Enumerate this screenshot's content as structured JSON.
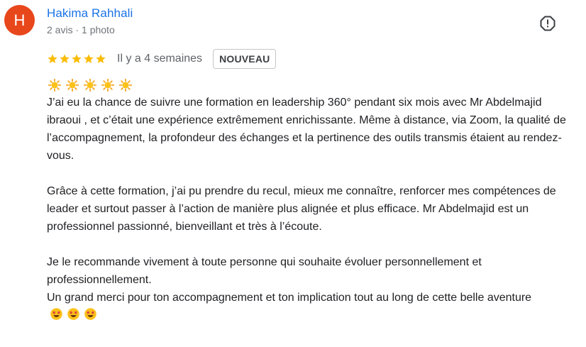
{
  "review": {
    "avatar_letter": "H",
    "avatar_color": "#e8471b",
    "author_name": "Hakima Rahhali",
    "author_meta": "2 avis · 1 photo",
    "report_icon": "report-icon",
    "rating": 5,
    "rating_max": 5,
    "star_color": "#fbbc04",
    "date": "Il y a 4 semaines",
    "badge": "NOUVEAU",
    "decor_icons": [
      "sun-emoji",
      "sun-emoji",
      "sun-emoji",
      "sun-emoji",
      "sun-emoji"
    ],
    "paragraphs": [
      "J’ai eu la chance de suivre une formation en leadership 360° pendant six mois avec Mr Abdelmajid ibraoui , et c’était une expérience extrêmement enrichissante. Même à distance, via Zoom, la qualité de l’accompagnement, la profondeur des échanges et la pertinence des outils transmis étaient au rendez-vous.",
      "Grâce à cette formation, j’ai pu prendre du recul, mieux me connaître, renforcer mes compétences de leader et surtout passer à l’action de manière plus alignée et plus efficace. Mr Abdelmajid est un professionnel passionné, bienveillant et très à l’écoute.",
      "Je le recommande vivement à toute personne qui souhaite évoluer personnellement et professionnellement.",
      "Un grand merci pour ton accompagnement et ton implication tout au long de cette belle aventure"
    ],
    "trailing_icons": [
      "star-struck-emoji",
      "star-struck-emoji",
      "star-struck-emoji"
    ]
  }
}
